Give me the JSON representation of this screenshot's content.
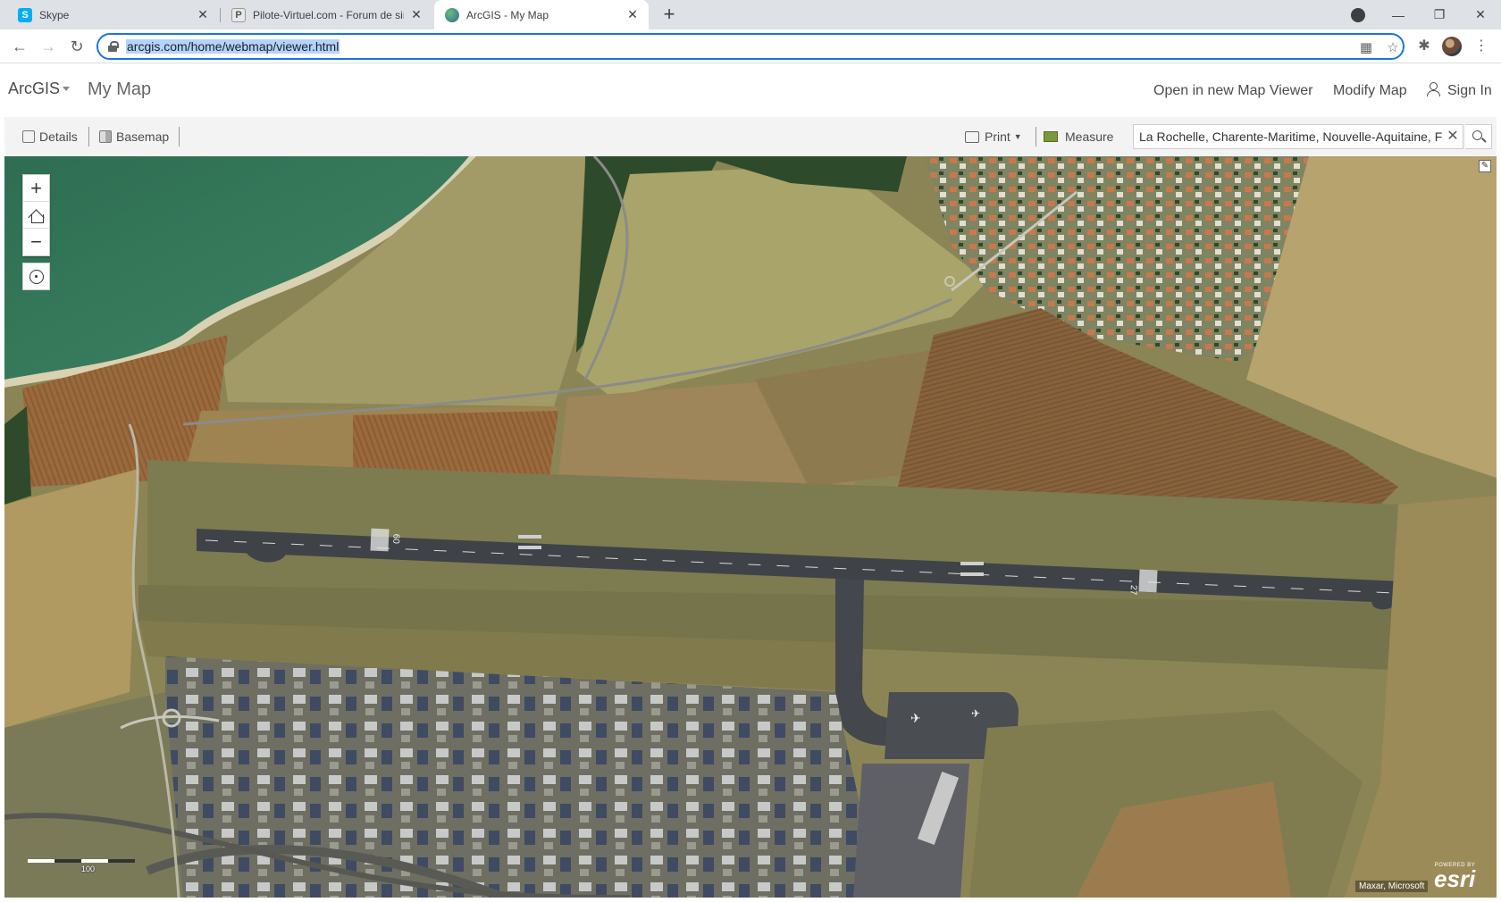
{
  "browser": {
    "tabs": [
      {
        "title": "Skype"
      },
      {
        "title": "Pilote-Virtuel.com - Forum de sim"
      },
      {
        "title": "ArcGIS - My Map"
      }
    ],
    "url": "arcgis.com/home/webmap/viewer.html"
  },
  "header": {
    "brand": "ArcGIS",
    "map_title": "My Map",
    "open_link": "Open in new Map Viewer",
    "modify_link": "Modify Map",
    "sign_in": "Sign In"
  },
  "toolbar": {
    "details": "Details",
    "basemap": "Basemap",
    "print": "Print",
    "measure": "Measure",
    "search_value": "La Rochelle, Charente-Maritime, Nouvelle-Aquitaine, F"
  },
  "map": {
    "zoom_in": "+",
    "zoom_out": "−",
    "runway_left": "09",
    "runway_right": "27",
    "scale_label": "100",
    "attribution": "Maxar, Microsoft",
    "logo_powered": "POWERED BY",
    "logo_name": "esri"
  },
  "colors": {
    "accent": "#1a73e8",
    "sea": "#2f6b4a",
    "field_light": "#a9a267",
    "runway": "#3f4348"
  }
}
